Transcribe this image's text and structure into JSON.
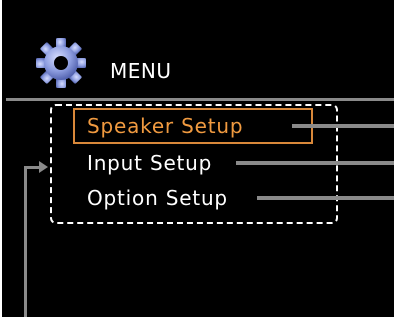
{
  "header": {
    "title": "MENU",
    "icon": "gear-icon"
  },
  "menu": {
    "items": [
      {
        "label": "Speaker Setup",
        "selected": true
      },
      {
        "label": "Input Setup",
        "selected": false
      },
      {
        "label": "Option Setup",
        "selected": false
      }
    ]
  },
  "colors": {
    "background": "#000000",
    "text": "#ffffff",
    "highlight": "#f09a40",
    "line": "#8a8a8a",
    "gear": "#8fa0e0"
  }
}
